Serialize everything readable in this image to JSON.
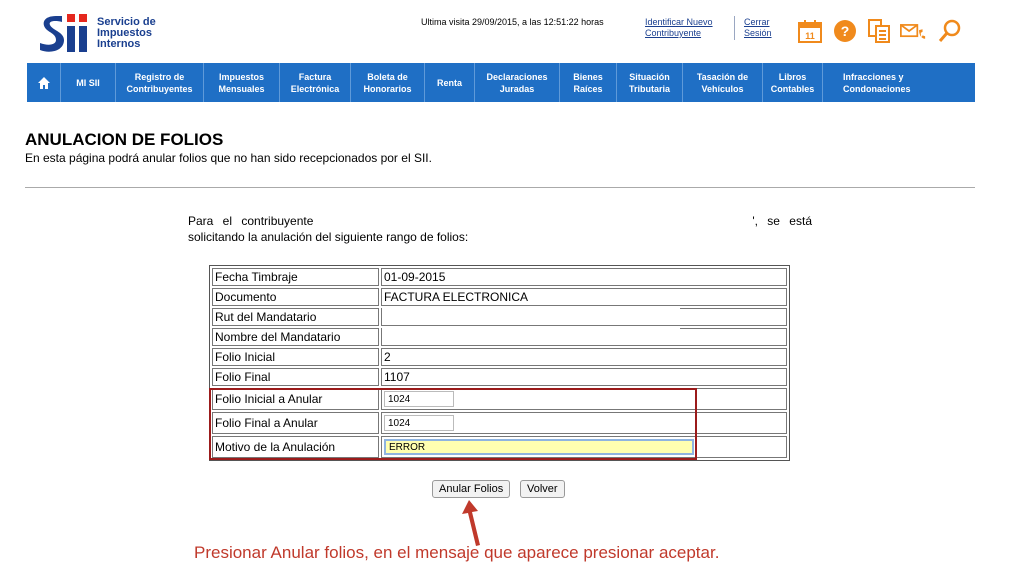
{
  "brand": {
    "l1": "Servicio de",
    "l2": "Impuestos",
    "l3": "Internos"
  },
  "header": {
    "visit": "Ultima visita 29/09/2015, a las 12:51:22 horas",
    "identify_l1": "Identificar Nuevo",
    "identify_l2": "Contribuyente",
    "logout_l1": "Cerrar",
    "logout_l2": "Sesión",
    "calendar_day": "11"
  },
  "nav": [
    {
      "l1": "MI SII",
      "l2": ""
    },
    {
      "l1": "Registro de",
      "l2": "Contribuyentes"
    },
    {
      "l1": "Impuestos",
      "l2": "Mensuales"
    },
    {
      "l1": "Factura",
      "l2": "Electrónica"
    },
    {
      "l1": "Boleta de",
      "l2": "Honorarios"
    },
    {
      "l1": "Renta",
      "l2": ""
    },
    {
      "l1": "Declaraciones",
      "l2": "Juradas"
    },
    {
      "l1": "Bienes",
      "l2": "Raíces"
    },
    {
      "l1": "Situación",
      "l2": "Tributaria"
    },
    {
      "l1": "Tasación de",
      "l2": "Vehículos"
    },
    {
      "l1": "Libros",
      "l2": "Contables"
    },
    {
      "l1": "Infracciones y",
      "l2": "Condonaciones"
    }
  ],
  "page": {
    "title": "ANULACION DE FOLIOS",
    "subtitle": "En esta página podrá anular folios que no han sido recepcionados por el SII.",
    "intro_a": "Para el contribuyente",
    "intro_b": "', se está",
    "intro_line2": "solicitando la anulación del siguiente rango de folios:"
  },
  "table": [
    {
      "label": "Fecha Timbraje",
      "value": "01-09-2015"
    },
    {
      "label": "Documento",
      "value": "FACTURA ELECTRONICA"
    },
    {
      "label": "Rut del Mandatario",
      "value": ""
    },
    {
      "label": "Nombre del Mandatario",
      "value": ""
    },
    {
      "label": "Folio Inicial",
      "value": "2"
    },
    {
      "label": "Folio Final",
      "value": "1107"
    }
  ],
  "form": {
    "folio_inicial_label": "Folio Inicial a Anular",
    "folio_inicial_value": "1024",
    "folio_final_label": "Folio Final a Anular",
    "folio_final_value": "1024",
    "motivo_label": "Motivo de la Anulación",
    "motivo_value": "ERROR"
  },
  "buttons": {
    "anular": "Anular Folios",
    "volver": "Volver"
  },
  "annotation": "Presionar Anular folios, en el mensaje que aparece presionar aceptar.",
  "colors": {
    "brand": "#1a3f8f",
    "nav": "#1f6fc5",
    "icons": "#f08a1c",
    "annotation": "#c0392b",
    "highlight": "#9b1b1b"
  },
  "icons": [
    "home-icon",
    "calendar-icon",
    "help-icon",
    "documents-icon",
    "mail-phone-icon",
    "search-icon"
  ]
}
